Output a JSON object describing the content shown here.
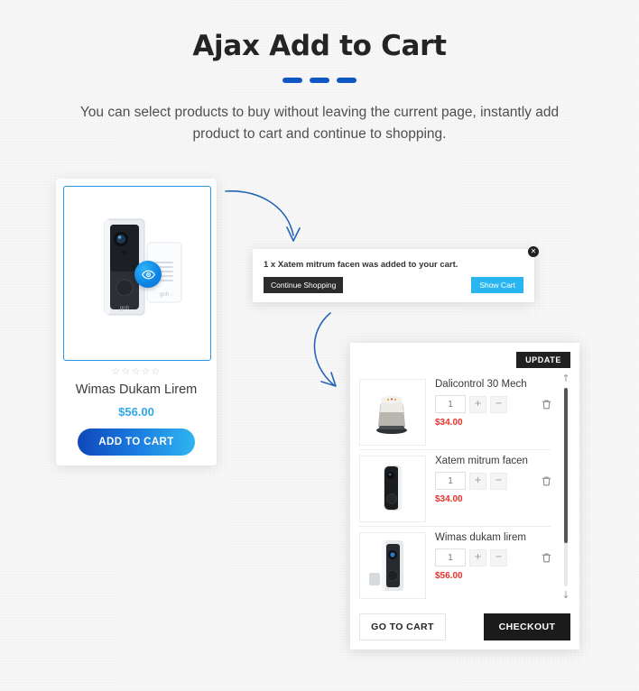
{
  "header": {
    "title": "Ajax Add to Cart",
    "subtitle": "You can select products to buy without leaving the current page, instantly add product to cart and continue to shopping.",
    "accent_color": "#1157c4"
  },
  "product_card": {
    "image_alt": "doorbell-camera",
    "quickview_icon": "eye-icon",
    "rating_stars": "☆☆☆☆☆",
    "rating_value": 0,
    "name": "Wimas Dukam Lirem",
    "price": "$56.00",
    "price_color": "#2fa8e8",
    "add_to_cart_label": "ADD TO CART"
  },
  "toast": {
    "message": "1 x Xatem mitrum facen was added to your cart.",
    "continue_label": "Continue Shopping",
    "show_cart_label": "Show Cart",
    "close_icon": "close-icon",
    "close_glyph": "✕",
    "show_cart_color": "#29b6f0",
    "continue_color": "#2b2b2b"
  },
  "cart": {
    "update_label": "UPDATE",
    "items": [
      {
        "name": "Dalicontrol 30 Mech",
        "qty": "1",
        "price": "$34.00",
        "thumb": "smart-speaker",
        "increase_glyph": "+",
        "decrease_glyph": "−",
        "remove_icon": "trash-icon"
      },
      {
        "name": "Xatem mitrum facen",
        "qty": "1",
        "price": "$34.00",
        "thumb": "black-doorbell",
        "increase_glyph": "+",
        "decrease_glyph": "−",
        "remove_icon": "trash-icon"
      },
      {
        "name": "Wimas dukam lirem",
        "qty": "1",
        "price": "$56.00",
        "thumb": "doorbell-set",
        "increase_glyph": "+",
        "decrease_glyph": "−",
        "remove_icon": "trash-icon"
      }
    ],
    "scrollbar": {
      "up_glyph": "↑",
      "down_glyph": "↓"
    },
    "go_to_cart_label": "GO TO CART",
    "checkout_label": "CHECKOUT",
    "price_color": "#e8312b"
  },
  "arrows": {
    "color": "#2463b5",
    "first_label": "product-to-toast",
    "second_label": "toast-to-cart"
  }
}
